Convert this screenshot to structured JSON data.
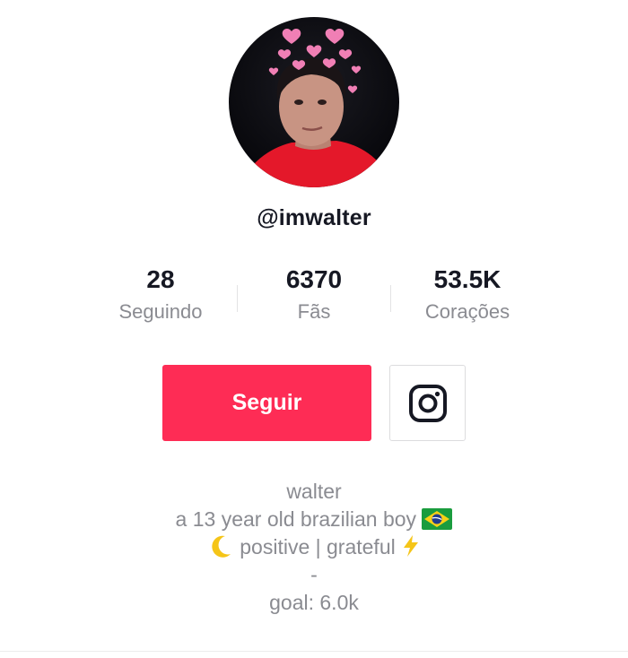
{
  "profile": {
    "username": "@imwalter",
    "avatar_icon": "profile-photo",
    "stats": [
      {
        "value": "28",
        "label": "Seguindo"
      },
      {
        "value": "6370",
        "label": "Fãs"
      },
      {
        "value": "53.5K",
        "label": "Corações"
      }
    ],
    "follow_label": "Seguir",
    "instagram_icon": "instagram-icon",
    "bio": {
      "name": "walter",
      "line1": "a 13 year old brazilian boy",
      "line1_emoji": "brazil-flag-icon",
      "line2_prefix_emoji": "crescent-moon-icon",
      "line2": "positive | grateful",
      "line2_suffix_emoji": "lightning-icon",
      "separator": "-",
      "goal": "goal: 6.0k"
    }
  },
  "colors": {
    "accent": "#fe2c55",
    "text_primary": "#161823",
    "text_secondary": "#8a8b91"
  }
}
